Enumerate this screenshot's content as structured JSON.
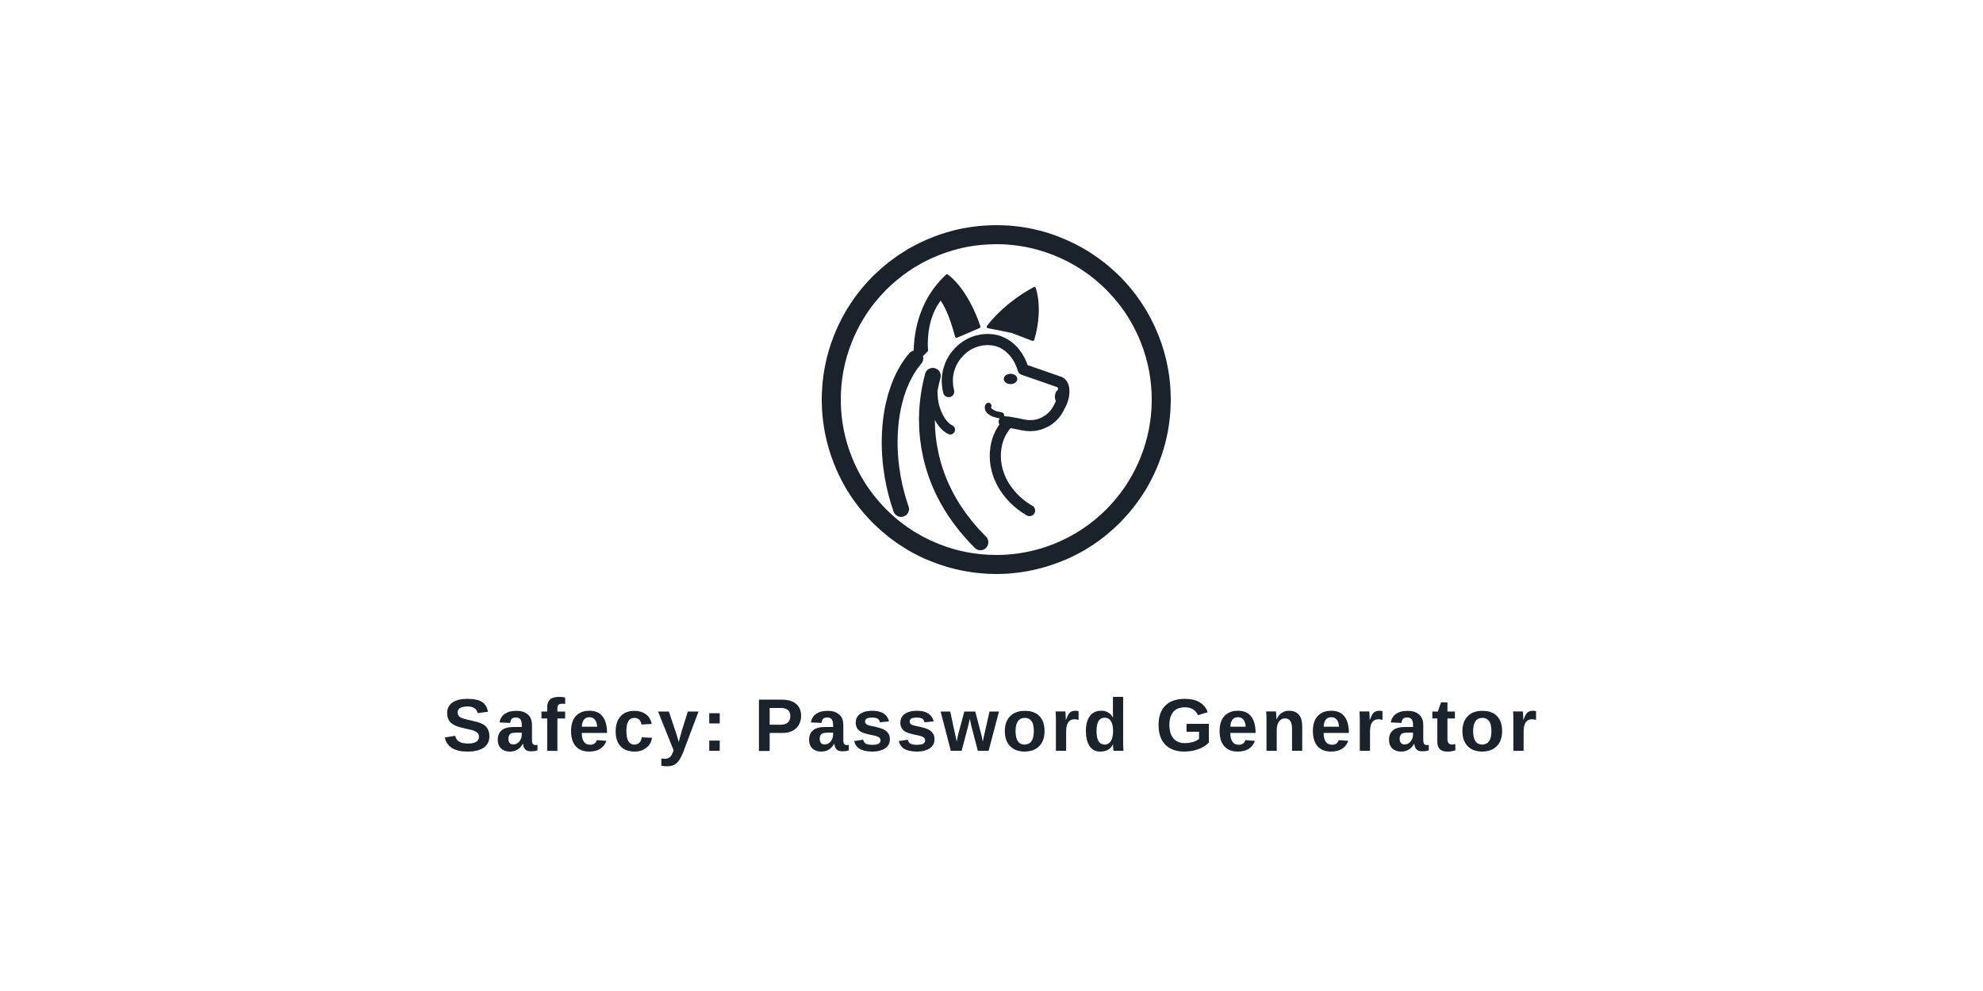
{
  "brand": {
    "logo_icon": "dog-head-circle-icon",
    "color": "#1a232b"
  },
  "title": "Safecy: Password Generator"
}
